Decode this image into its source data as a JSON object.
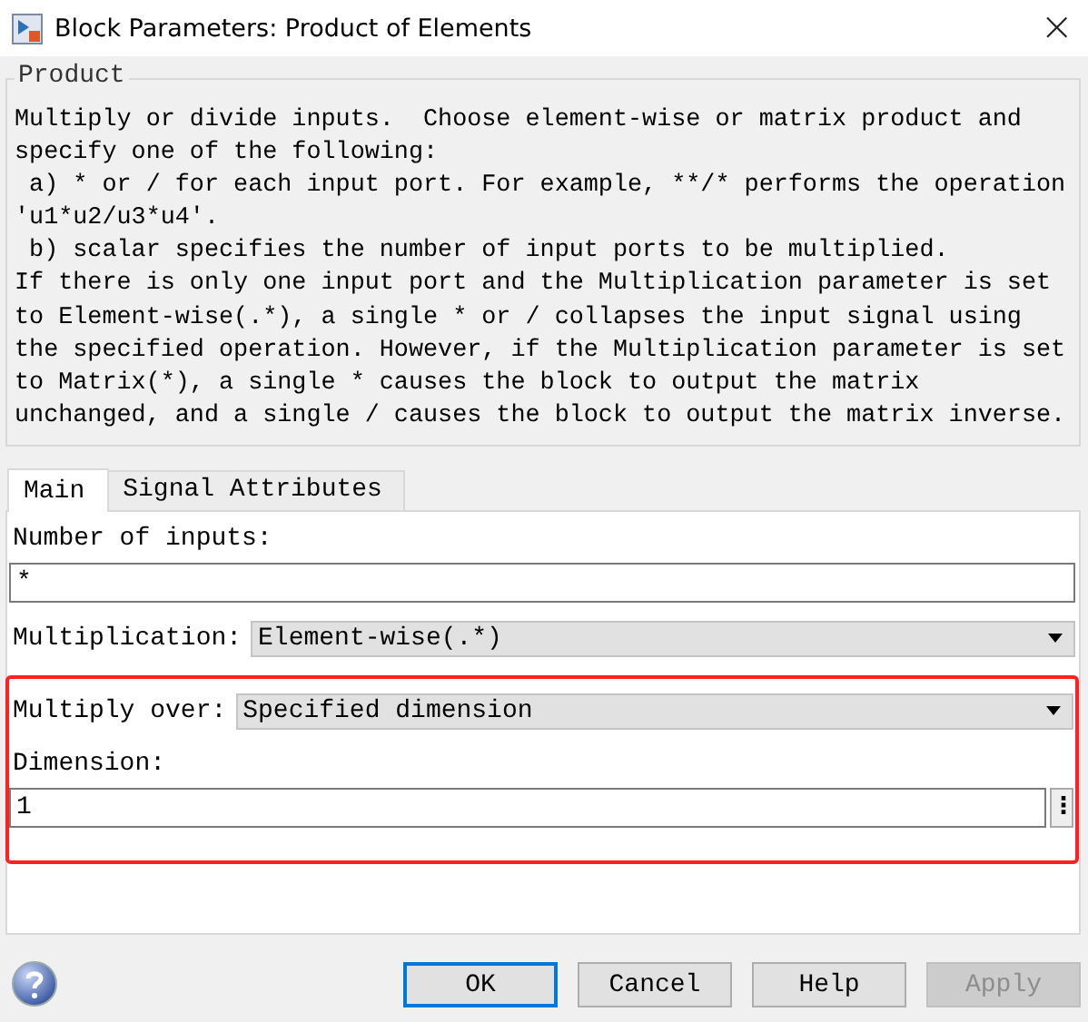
{
  "window": {
    "title": "Block Parameters: Product of Elements",
    "close": "×"
  },
  "group": {
    "title": "Product",
    "description": "Multiply or divide inputs.  Choose element-wise or matrix product and\nspecify one of the following:\n a) * or / for each input port. For example, **/* performs the operation\n'u1*u2/u3*u4'.\n b) scalar specifies the number of input ports to be multiplied.\nIf there is only one input port and the Multiplication parameter is set\nto Element-wise(.*), a single * or / collapses the input signal using\nthe specified operation. However, if the Multiplication parameter is set\nto Matrix(*), a single * causes the block to output the matrix\nunchanged, and a single / causes the block to output the matrix inverse."
  },
  "tabs": [
    {
      "label": "Main",
      "selected": true
    },
    {
      "label": "Signal Attributes",
      "selected": false
    }
  ],
  "params": [
    {
      "kind": "field",
      "label": "Number of inputs:",
      "value": "*",
      "highlighted": false
    },
    {
      "kind": "dropdown",
      "label": "Multiplication:",
      "value": "Element-wise(.*)",
      "highlighted": false
    },
    {
      "kind": "dropdown",
      "label": "Multiply over:",
      "value": "Specified dimension",
      "highlighted": true
    },
    {
      "kind": "field-more",
      "label": "Dimension:",
      "value": "1",
      "more": "⋮",
      "highlighted": true
    }
  ],
  "buttons": [
    {
      "label": "OK",
      "default": true,
      "disabled": false
    },
    {
      "label": "Cancel",
      "default": false,
      "disabled": false
    },
    {
      "label": "Help",
      "default": false,
      "disabled": false
    },
    {
      "label": "Apply",
      "default": false,
      "disabled": true
    }
  ]
}
